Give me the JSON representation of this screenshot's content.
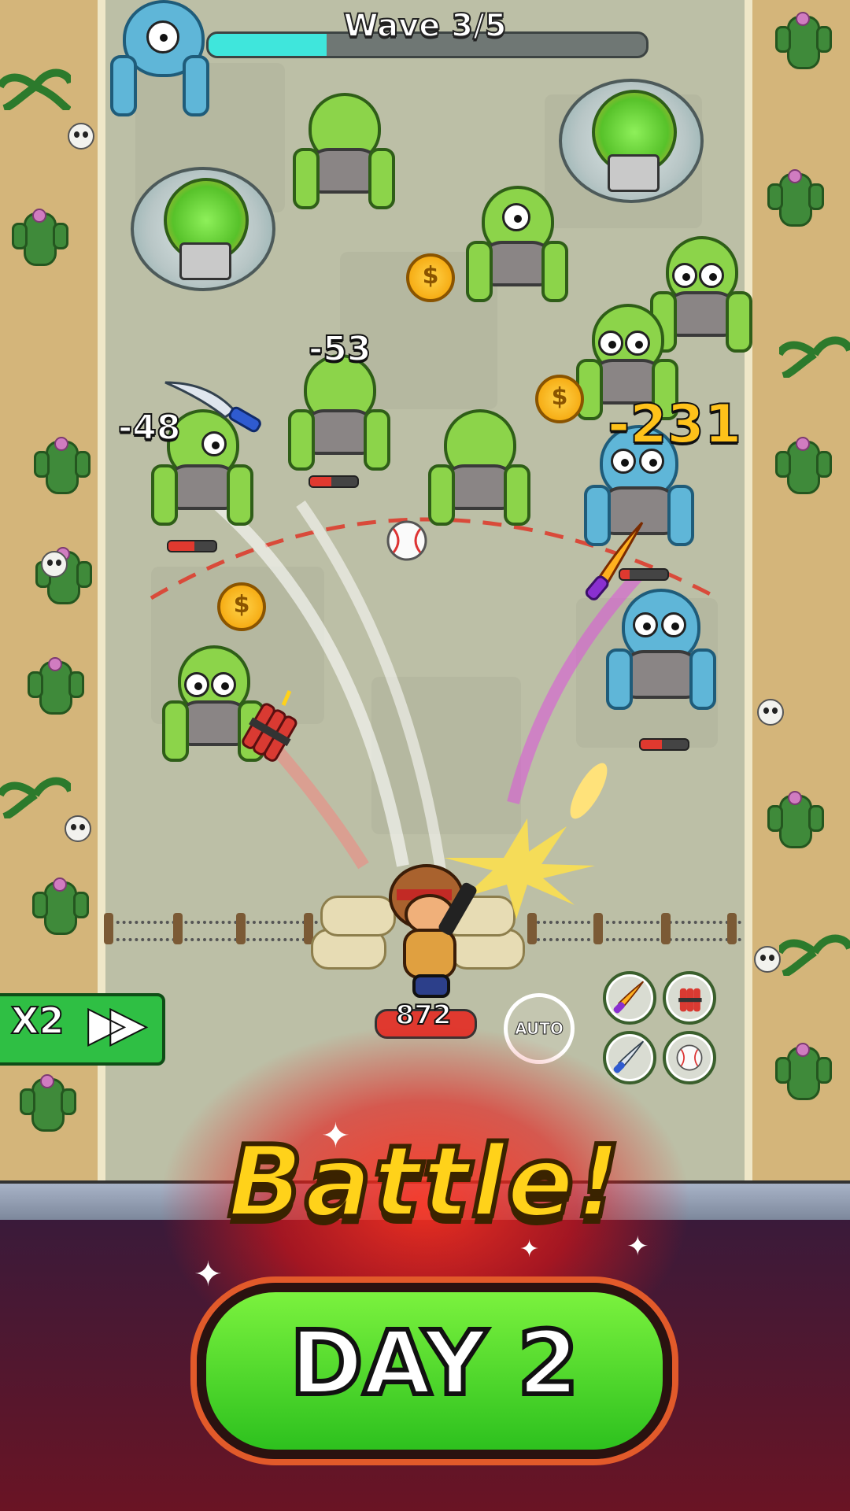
{
  "hud": {
    "wave_label": "Wave 3/5",
    "wave_progress": 0.27
  },
  "damage_numbers": [
    "-48",
    "-53",
    "-231"
  ],
  "coin_symbol": "$",
  "hero": {
    "hp": "872"
  },
  "controls": {
    "auto_label": "AUTO",
    "speed_label": "X2",
    "speed_icon": "fast-forward-icon",
    "weapon_slots": [
      "flame-knife-icon",
      "dynamite-icon",
      "combat-knife-icon",
      "baseball-icon"
    ]
  },
  "banner": {
    "title": "Battle!",
    "button_label": "DAY 2"
  },
  "colors": {
    "wave_fill": "#3fe6dc",
    "hp_bar": "#e0392f",
    "button_green": "#2dc11e",
    "title_yellow": "#ffd21a"
  }
}
